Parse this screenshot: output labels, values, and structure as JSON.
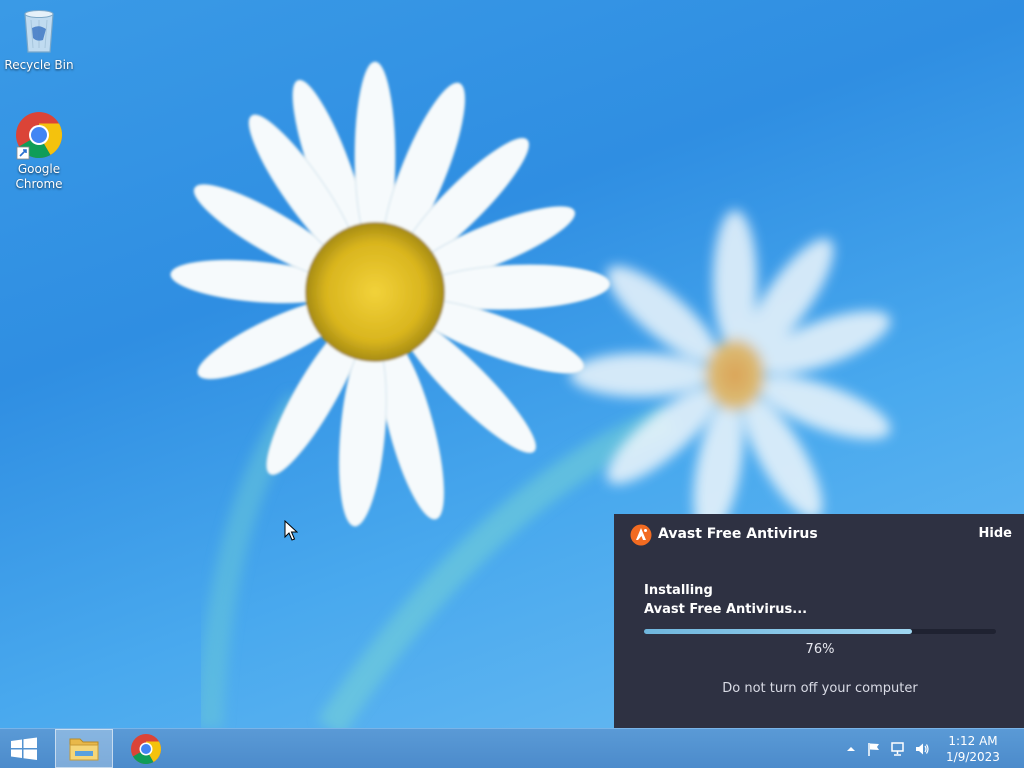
{
  "desktop": {
    "icons": [
      {
        "label": "Recycle Bin",
        "icon": "recycle-bin-icon"
      },
      {
        "label": "Google\nChrome",
        "icon": "chrome-icon"
      }
    ]
  },
  "avast": {
    "title": "Avast Free Antivirus",
    "hide_label": "Hide",
    "status_line1": "Installing",
    "status_line2": "Avast Free Antivirus...",
    "progress": 0.76,
    "progress_text": "76%",
    "warning": "Do not turn off your computer",
    "colors": {
      "panel": "#2e3142",
      "accent": "#f26b21",
      "bar": "#8ccbec"
    }
  },
  "taskbar": {
    "items": [
      {
        "name": "start",
        "icon": "windows-logo-icon"
      },
      {
        "name": "file-explorer",
        "icon": "folder-icon",
        "active": true
      },
      {
        "name": "google-chrome",
        "icon": "chrome-icon"
      }
    ],
    "tray": {
      "icons": [
        "show-hidden-icons-icon",
        "flag-icon",
        "network-icon",
        "volume-icon"
      ],
      "time": "1:12 AM",
      "date": "1/9/2023"
    }
  }
}
